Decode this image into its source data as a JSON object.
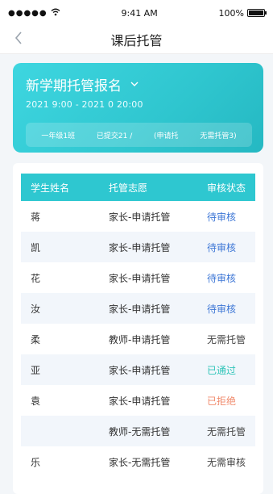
{
  "status_bar": {
    "signal": "●●●●●",
    "time": "9:41 AM",
    "battery": "100%"
  },
  "nav": {
    "title": "课后托管"
  },
  "card": {
    "title": "新学期托管报名",
    "time": "2021    9:00 - 2021    0 20:00",
    "stats": [
      "一年级1班",
      "已提交21 /",
      "(申请托",
      "无需托管3)"
    ]
  },
  "table": {
    "headers": [
      "学生姓名",
      "托管志愿",
      "审核状态"
    ],
    "rows": [
      {
        "name": "蒋",
        "wish": "家长-申请托管",
        "status": "待审核",
        "type": "pending"
      },
      {
        "name": "凯",
        "wish": "家长-申请托管",
        "status": "待审核",
        "type": "pending"
      },
      {
        "name": "花",
        "wish": "家长-申请托管",
        "status": "待审核",
        "type": "pending"
      },
      {
        "name": "汝",
        "wish": "家长-申请托管",
        "status": "待审核",
        "type": "pending"
      },
      {
        "name": "柔",
        "wish": "教师-申请托管",
        "status": "无需托管",
        "type": "none"
      },
      {
        "name": "亚",
        "wish": "家长-申请托管",
        "status": "已通过",
        "type": "pass"
      },
      {
        "name": "袁",
        "wish": "家长-申请托管",
        "status": "已拒绝",
        "type": "reject"
      },
      {
        "name": "",
        "wish": "教师-无需托管",
        "status": "无需托管",
        "type": "none"
      },
      {
        "name": "乐",
        "wish": "家长-无需托管",
        "status": "无需审核",
        "type": "none"
      }
    ]
  }
}
